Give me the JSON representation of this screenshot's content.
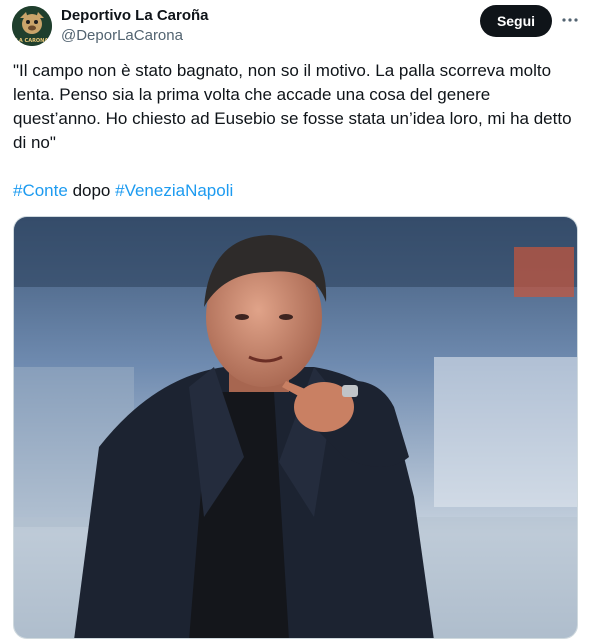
{
  "author": {
    "display_name": "Deportivo La Caroña",
    "handle": "@DeporLaCarona",
    "avatar_text": "LA CARONA"
  },
  "actions": {
    "follow_label": "Segui",
    "more_icon": "more-horizontal-icon"
  },
  "tweet": {
    "text": "\"Il campo non è stato bagnato, non so il motivo. La palla scorreva molto lenta. Penso sia la prima volta che accade una cosa del genere quest’anno. Ho chiesto ad Eusebio se fosse stata un’idea loro, mi ha detto di no\"",
    "hashtag_1": "#Conte",
    "connector": "dopo",
    "hashtag_2": "#VeneziaNapoli"
  },
  "colors": {
    "hashtag": "#1d9bf0",
    "follow_button": "#0f1419",
    "handle": "#536471"
  }
}
